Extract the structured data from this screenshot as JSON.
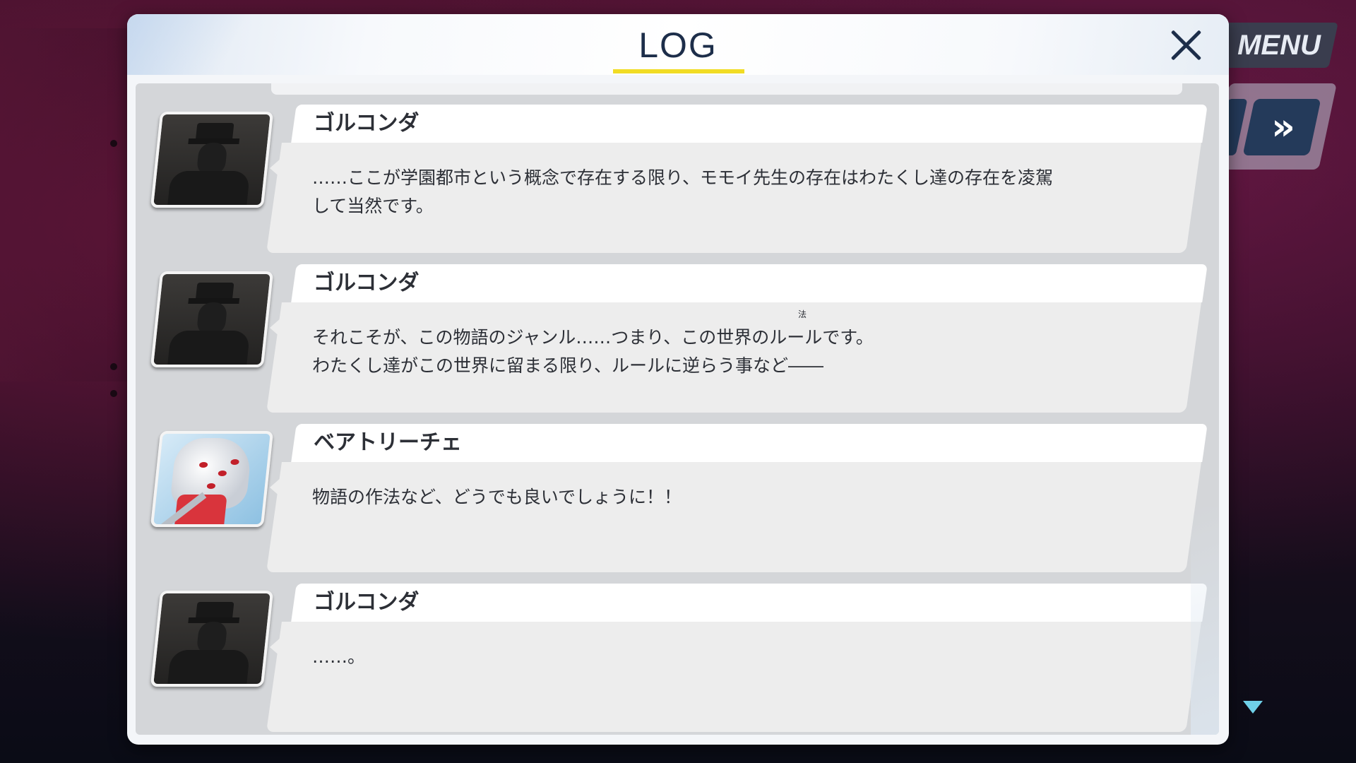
{
  "hud": {
    "menu_label": "MENU",
    "skip_icon": "»",
    "scroll_down_icon": "triangle-down-icon"
  },
  "log": {
    "title": "LOG",
    "close_icon": "close-icon",
    "entries": [
      {
        "speaker": "ゴルコンダ",
        "avatar": "silhouette-portrait",
        "text": "……ここが学園都市という概念で存在する限り、モモイ先生の存在はわたくし達の存在を凌駕\nして当然です。"
      },
      {
        "speaker": "ゴルコンダ",
        "avatar": "silhouette-portrait",
        "ruby": "法",
        "text": "それこそが、この物語のジャンル……つまり、この世界のルールです。\nわたくし達がこの世界に留まる限り、ルールに逆らう事など――"
      },
      {
        "speaker": "ベアトリーチェ",
        "avatar": "beatrice-portrait",
        "text": "物語の作法など、どうでも良いでしょうに！！"
      },
      {
        "speaker": "ゴルコンダ",
        "avatar": "silhouette-portrait",
        "text": "……。"
      }
    ]
  },
  "colors": {
    "title_underline": "#f1dc24",
    "title_text": "#1d2e4a",
    "skip_button": "#243a5a",
    "scroll_indicator": "#6fd0e8"
  }
}
